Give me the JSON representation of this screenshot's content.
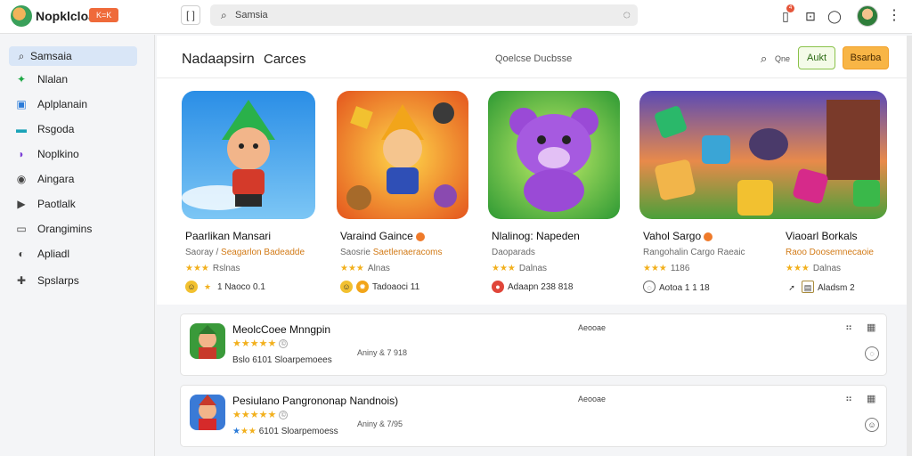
{
  "app": {
    "title": "Nopklcloai",
    "badge": "K=K",
    "sidebar_toggle": "[ ]",
    "search_placeholder": "Samsia",
    "notification_count": "4"
  },
  "sidebar": {
    "items": [
      {
        "label": "Samsaia",
        "icon": "search-icon",
        "color": "#333333"
      },
      {
        "label": "Nlalan",
        "icon": "gamepad-icon",
        "color": "#1ea845"
      },
      {
        "label": "Aplplanain",
        "icon": "book-icon",
        "color": "#2b7bd8"
      },
      {
        "label": "Rsgoda",
        "icon": "card-icon",
        "color": "#1aa3b8"
      },
      {
        "label": "Noplkino",
        "icon": "controller-icon",
        "color": "#7b3fd6"
      },
      {
        "label": "Aingara",
        "icon": "camera-icon",
        "color": "#444444"
      },
      {
        "label": "Paotlalk",
        "icon": "video-icon",
        "color": "#444444"
      },
      {
        "label": "Orangimins",
        "icon": "monitor-icon",
        "color": "#444444"
      },
      {
        "label": "Apliadl",
        "icon": "play-icon",
        "color": "#444444"
      },
      {
        "label": "Spslarps",
        "icon": "puzzle-icon",
        "color": "#444444"
      }
    ]
  },
  "main": {
    "heading": "Nadaapsirn",
    "subtab": "Carces",
    "filter_text": "Qoelcse Ducbsse",
    "search_label": "Qne",
    "btn_add": "Aukt",
    "btn_primary": "Bsarba"
  },
  "games": [
    {
      "title": "Paarlikan Mansari",
      "sub": "Saoray /",
      "sub_hl": "Seagarlon Badeadde",
      "stars": "★★★",
      "rating_label": "Rslnas",
      "meta": "1 Naoco 0.1"
    },
    {
      "title": "Varaind Gaince",
      "sub": "Saosrie",
      "sub_hl": "Saetlenaeracoms",
      "stars": "★★★",
      "rating_label": "Alnas",
      "meta": "Tadoaoci 11"
    },
    {
      "title": "Nlalinog: Napeden",
      "sub": "Daoparads",
      "sub_hl": "",
      "stars": "★★★",
      "rating_label": "Dalnas",
      "meta": "Adaapn 238 818"
    },
    {
      "title": "Vahol Sargo",
      "sub": "Rangohalin Cargo",
      "sub_hl": "Raeaic",
      "stars": "★★★",
      "rating_label": "1186",
      "meta": "Aotoa 1 1 18"
    },
    {
      "title": "Viaoarl Borkals",
      "sub": "",
      "sub_hl": "Raoo Doosemnecaoie",
      "stars": "★★★",
      "rating_label": "Dalnas",
      "meta": "Aladsm 2"
    }
  ],
  "rows": [
    {
      "title": "MeolcCoee Mnngpin",
      "stars": "★★★★★",
      "meta": "Bslo 6101 Sloarpemoees",
      "mid": "Aniny & 7 918",
      "right": "Aeooae"
    },
    {
      "title": "Pesiulano Pangrononap Nandnois)",
      "stars": "★★★★★",
      "meta": "6101 Sloarpemoess",
      "mid": "Aniny & 7/95",
      "right": "Aeooae"
    }
  ]
}
